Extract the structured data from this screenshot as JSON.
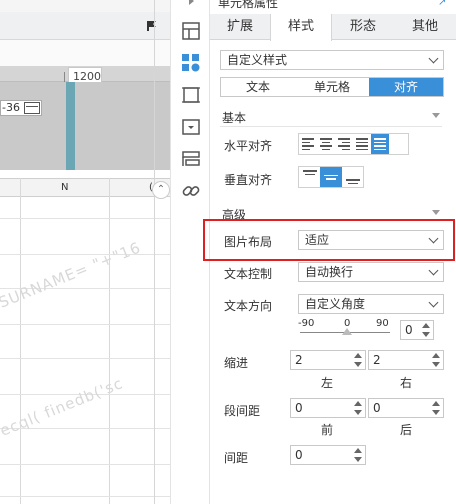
{
  "canvas": {
    "ruler_number": "1200",
    "date_text": "-36",
    "columns": [
      "N",
      "("
    ],
    "watermark": [
      "SURNAME= \"+\"16",
      "ecql( finedb('sc"
    ]
  },
  "panel": {
    "title": "单元格属性",
    "tabs": [
      {
        "label": "扩展",
        "active": false
      },
      {
        "label": "样式",
        "active": true
      },
      {
        "label": "形态",
        "active": false
      },
      {
        "label": "其他",
        "active": false
      }
    ],
    "style_select": "自定义样式",
    "seg_tabs": [
      {
        "label": "文本",
        "active": false
      },
      {
        "label": "单元格",
        "active": false
      },
      {
        "label": "对齐",
        "active": true
      }
    ],
    "basic_section": "基本",
    "h_align_label": "水平对齐",
    "v_align_label": "垂直对齐",
    "advanced_section": "高级",
    "image_layout_label": "图片布局",
    "image_layout_value": "适应",
    "text_control_label": "文本控制",
    "text_control_value": "自动换行",
    "text_direction_label": "文本方向",
    "text_direction_value": "自定义角度",
    "angle_min": "-90",
    "angle_mid": "0",
    "angle_max": "90",
    "angle_value": "0",
    "indent_label": "缩进",
    "indent_left": "2",
    "indent_right": "2",
    "left_label": "左",
    "right_label": "右",
    "para_spacing_label": "段间距",
    "para_before": "0",
    "para_after": "0",
    "before_label": "前",
    "after_label": "后",
    "line_spacing_label": "间距",
    "line_spacing": "0"
  },
  "colors": {
    "accent": "#3a8fd9",
    "highlight": "#e02020"
  }
}
